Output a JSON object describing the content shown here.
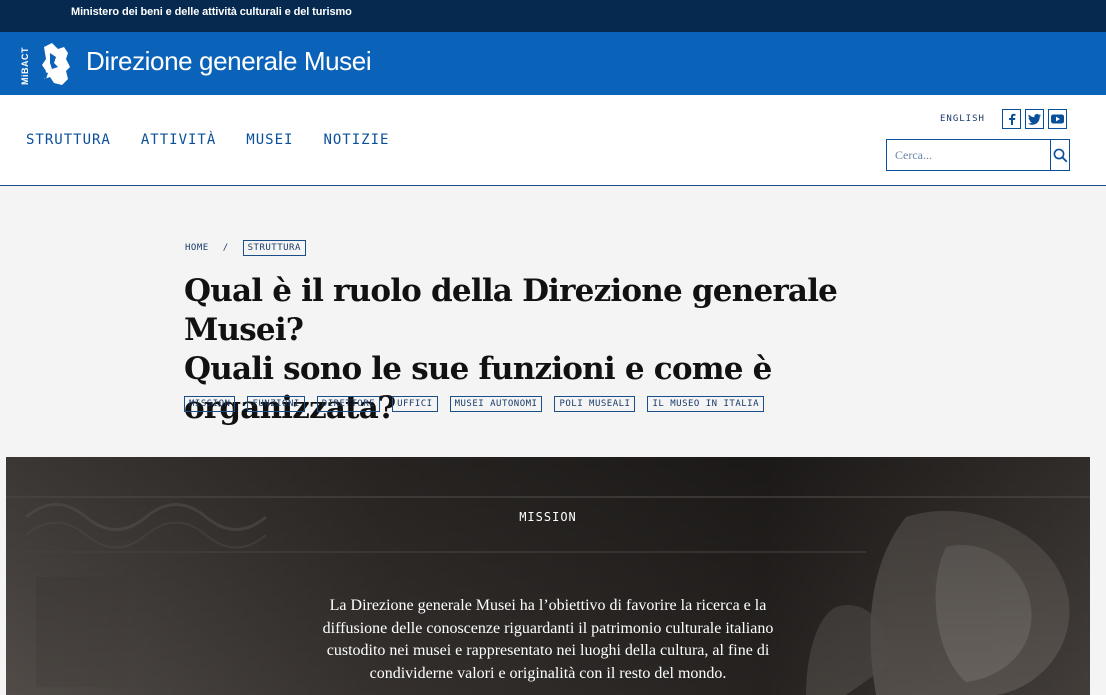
{
  "topbar": {
    "ministry": "Ministero dei beni e delle attività culturali e del turismo"
  },
  "brand": {
    "logo_text": "MiBACT",
    "title": "Direzione generale Musei"
  },
  "nav": {
    "items": [
      "STRUTTURA",
      "ATTIVITÀ",
      "MUSEI",
      "NOTIZIE"
    ],
    "language": "ENGLISH",
    "socials": [
      "facebook-icon",
      "twitter-icon",
      "youtube-icon"
    ],
    "search_placeholder": "Cerca..."
  },
  "breadcrumb": {
    "home": "HOME",
    "separator": "/",
    "current": "STRUTTURA"
  },
  "headline": {
    "line1": "Qual è il ruolo della Direzione generale Musei?",
    "line2": "Quali sono le sue funzioni e come è organizzata?"
  },
  "tags": [
    "MISSION",
    "FUNZIONI",
    "DIRETTORE",
    "UFFICI",
    "MUSEI AUTONOMI",
    "POLI MUSEALI",
    "IL MUSEO IN ITALIA"
  ],
  "hero": {
    "label": "MISSION",
    "text": "La Direzione generale Musei ha l’obiettivo di favorire la ricerca e la diffusione delle conoscenze riguardanti il patrimonio culturale italiano custodito nei musei e rappresentato nei luoghi della cultura, al fine di condividerne valori e originalità con il resto del mondo."
  },
  "colors": {
    "topbar": "#062a4f",
    "brand": "#0a63b8",
    "link": "#0a4f9a"
  }
}
